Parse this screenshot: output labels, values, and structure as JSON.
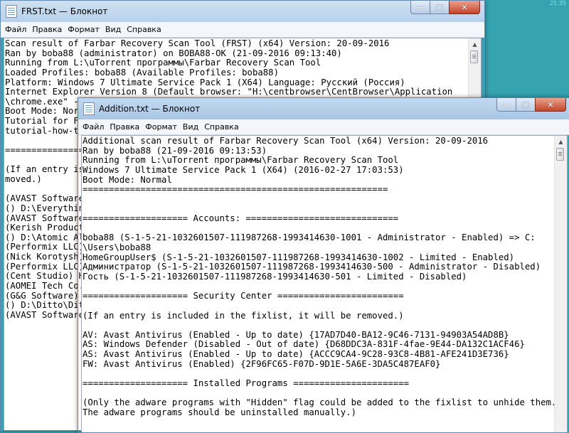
{
  "desktop": {
    "clock": "21:35"
  },
  "back_window": {
    "title": "FRST.txt — Блокнот",
    "menu": [
      "Файл",
      "Правка",
      "Формат",
      "Вид",
      "Справка"
    ],
    "lines": [
      "Scan result of Farbar Recovery Scan Tool (FRST) (x64) Version: 20-09-2016",
      "Ran by boba88 (administrator) on BOBA88-OK (21-09-2016 09:13:40)",
      "Running from L:\\uTorrent программы\\Farbar Recovery Scan Tool",
      "Loaded Profiles: boba88 (Available Profiles: boba88)",
      "Platform: Windows 7 Ultimate Service Pack 1 (X64) Language: Русский (Россия)",
      "Internet Explorer Version 8 (Default browser: \"H:\\centbrowser\\CentBrowser\\Application",
      "\\chrome.exe\" --",
      "Boot Mode: Norm",
      "Tutorial for Fa",
      "tutorial-how-to",
      "",
      "===============",
      "",
      "(If an entry is",
      "moved.)",
      "",
      "(AVAST Software",
      "() D:\\Everythin",
      "(AVAST Software",
      "(Kerish Product",
      "() D:\\Atomic Al",
      "(Performix LLC)",
      "(Nick Korotysh)",
      "(Performix LLC)",
      "(Cent Studio) H",
      "(AOMEI Tech Co.",
      "(G&G Software)",
      "() D:\\Ditto\\Dit",
      "(AVAST Software"
    ]
  },
  "front_window": {
    "title": "Addition.txt — Блокнот",
    "menu": [
      "Файл",
      "Правка",
      "Формат",
      "Вид",
      "Справка"
    ],
    "lines": [
      "Additional scan result of Farbar Recovery Scan Tool (x64) Version: 20-09-2016",
      "Ran by boba88 (21-09-2016 09:13:53)",
      "Running from L:\\uTorrent программы\\Farbar Recovery Scan Tool",
      "Windows 7 Ultimate Service Pack 1 (X64) (2016-02-27 17:03:53)",
      "Boot Mode: Normal",
      "==========================================================",
      "",
      "",
      "==================== Accounts: =============================",
      "",
      "boba88 (S-1-5-21-1032601507-111987268-1993414630-1001 - Administrator - Enabled) => C:",
      "\\Users\\boba88",
      "HomeGroupUser$ (S-1-5-21-1032601507-111987268-1993414630-1002 - Limited - Enabled)",
      "Администратор (S-1-5-21-1032601507-111987268-1993414630-500 - Administrator - Disabled)",
      "Гость (S-1-5-21-1032601507-111987268-1993414630-501 - Limited - Disabled)",
      "",
      "==================== Security Center ========================",
      "",
      "(If an entry is included in the fixlist, it will be removed.)",
      "",
      "AV: Avast Antivirus (Enabled - Up to date) {17AD7D40-BA12-9C46-7131-94903A54AD8B}",
      "AS: Windows Defender (Disabled - Out of date) {D68DDC3A-831F-4fae-9E44-DA132C1ACF46}",
      "AS: Avast Antivirus (Enabled - Up to date) {ACCC9CA4-9C28-93C8-4B81-AFE241D3E736}",
      "FW: Avast Antivirus (Enabled) {2F96FC65-F07D-9D1E-5A6E-3DA5C487EAF0}",
      "",
      "==================== Installed Programs ======================",
      "",
      "(Only the adware programs with \"Hidden\" flag could be added to the fixlist to unhide them.",
      "The adware programs should be uninstalled manually.)"
    ]
  },
  "window_controls": {
    "minimize": "—",
    "maximize": "□",
    "close": "✕"
  },
  "icons": [
    "notepad-icon",
    "minimize-icon",
    "maximize-icon",
    "close-icon",
    "scroll-up-icon"
  ]
}
